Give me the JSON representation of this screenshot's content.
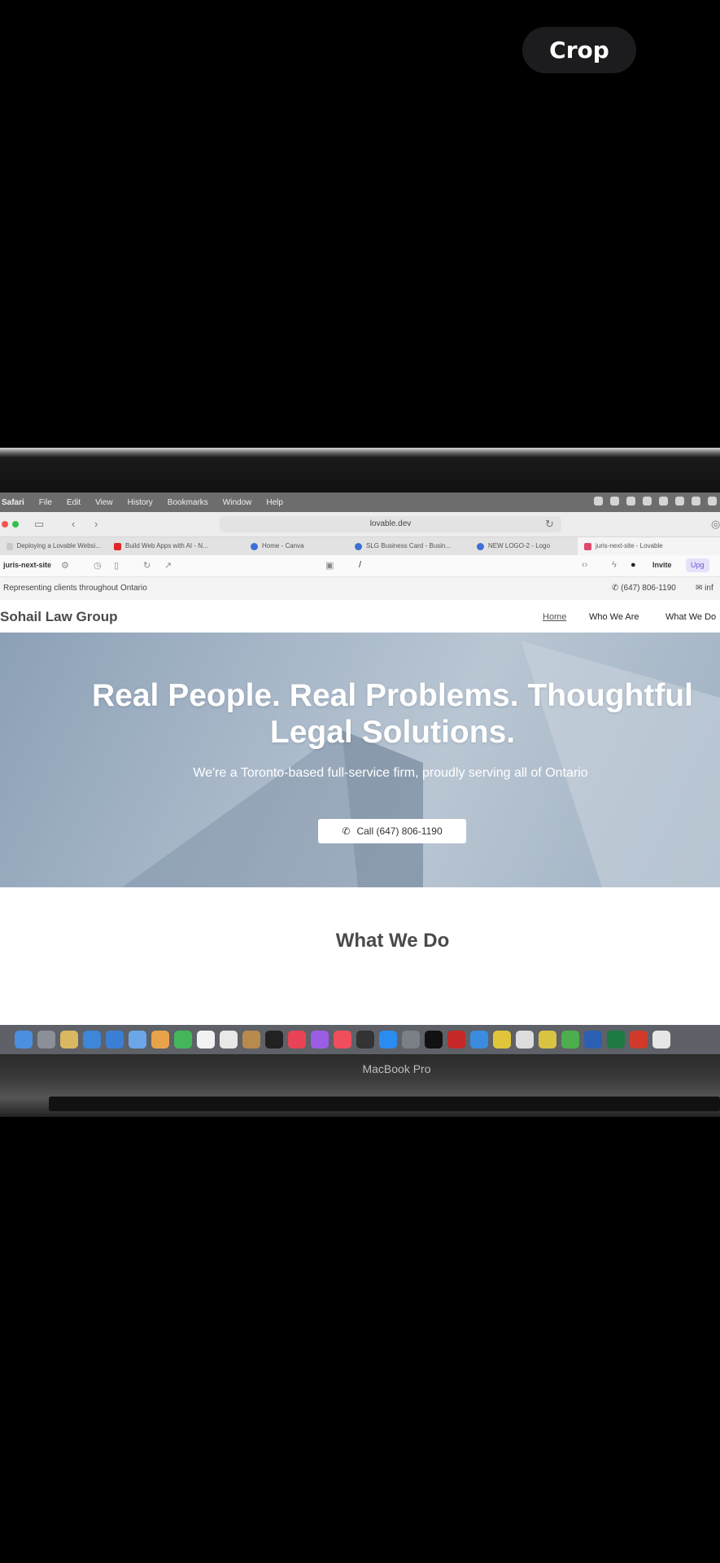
{
  "overlay": {
    "crop_label": "Crop"
  },
  "menubar": {
    "items": [
      "Safari",
      "File",
      "Edit",
      "View",
      "History",
      "Bookmarks",
      "Window",
      "Help"
    ]
  },
  "browser": {
    "url": "lovable.dev",
    "tabs": [
      {
        "label": "Deploying a Lovable Websi...",
        "icon": "page-icon",
        "color": "#c9c9c9"
      },
      {
        "label": "Build Web Apps with AI - N...",
        "icon": "youtube-icon",
        "color": "#e02727"
      },
      {
        "label": "Home - Canva",
        "icon": "canva-icon",
        "color": "#3f6fd6"
      },
      {
        "label": "SLG Business Card - Busin...",
        "icon": "canva-icon",
        "color": "#3f6fd6"
      },
      {
        "label": "NEW LOGO-2 - Logo",
        "icon": "canva-icon",
        "color": "#3f6fd6"
      },
      {
        "label": "juris-next-site - Lovable",
        "icon": "lovable-icon",
        "color": "#e0486b"
      }
    ]
  },
  "lovable": {
    "project_name": "juris-next-site",
    "path": "/",
    "invite_label": "Invite",
    "upgrade_label": "Upg"
  },
  "site": {
    "tagline": "Representing clients throughout Ontario",
    "phone": "(647) 806-1190",
    "email_partial": "inf",
    "brand": "Sohail Law Group",
    "nav": [
      "Home",
      "Who We Are",
      "What We Do"
    ],
    "hero_title_line1": "Real People. Real Problems. Thoughtful",
    "hero_title_line2": "Legal Solutions.",
    "hero_subtitle": "We're a Toronto-based full-service firm, proudly serving all of Ontario",
    "cta_label": "Call (647) 806-1190",
    "section_title": "What We Do"
  },
  "laptop": {
    "label": "MacBook Pro"
  }
}
